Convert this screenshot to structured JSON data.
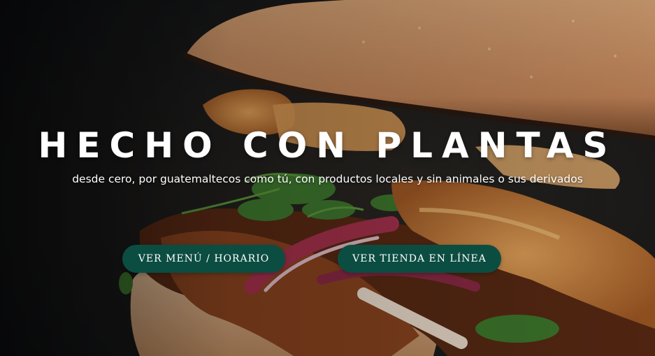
{
  "hero": {
    "title": "HECHO CON PLANTAS",
    "subtitle": "desde cero, por guatemaltecos como tú, con productos locales y sin animales o sus derivados",
    "image_icon": "sandwich-photo"
  },
  "buttons": {
    "menu_label": "VER MENÚ / HORARIO",
    "store_label": "VER TIENDA EN LÍNEA"
  },
  "colors": {
    "button_bg": "#0c4d42",
    "title_text": "#ffffff",
    "background": "#171a1e"
  }
}
